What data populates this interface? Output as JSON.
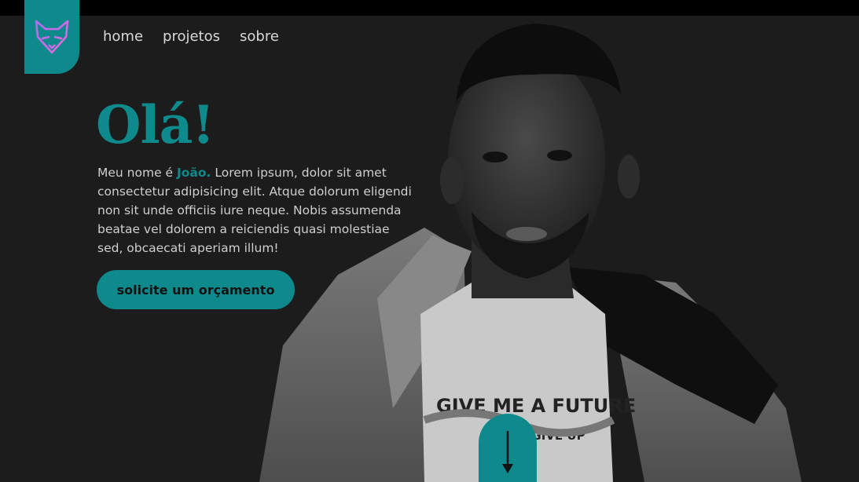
{
  "brand": {
    "logo_icon": "fox-icon",
    "accent": "#0e8a8c"
  },
  "nav": {
    "items": [
      {
        "label": "home"
      },
      {
        "label": "projetos"
      },
      {
        "label": "sobre"
      }
    ]
  },
  "hero": {
    "greeting": "Olá!",
    "intro_prefix": "Meu nome é ",
    "name": "João.",
    "intro_body": " Lorem ipsum, dolor sit amet consectetur adipisicing elit. Atque dolorum eligendi non sit unde officiis iure neque. Nobis assumenda beatae vel dolorem a reiciendis quasi molestiae sed, obcaecati aperiam illum!",
    "cta_label": "solicite um orçamento",
    "shirt_text_line1": "GIVE ME A FUTURE",
    "shirt_text_line2": "NEVER GIVE UP",
    "scroll_icon": "arrow-down-icon"
  }
}
